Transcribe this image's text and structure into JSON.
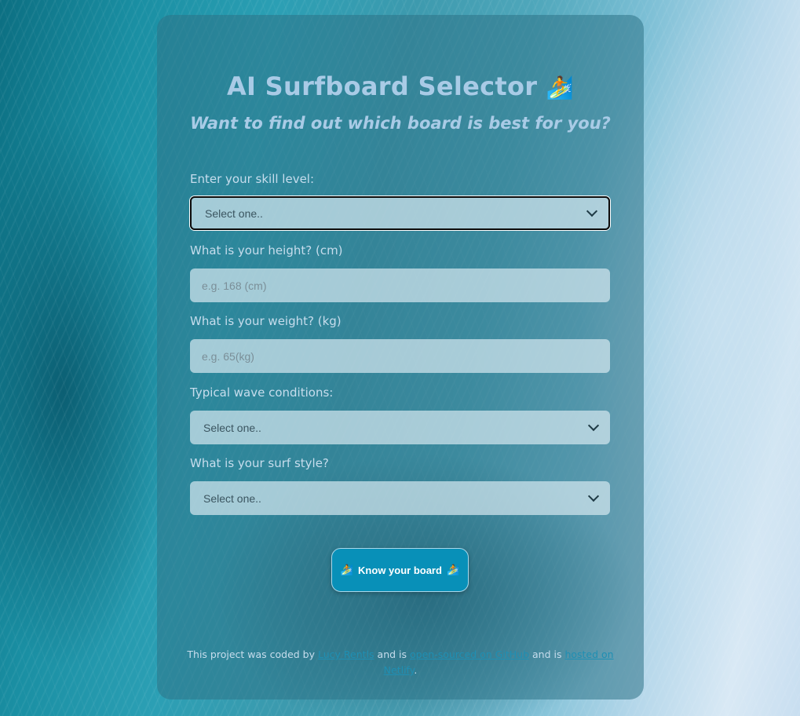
{
  "header": {
    "title": "AI Surfboard Selector",
    "title_emoji": "🏄",
    "subtitle": "Want to find out which board is best for you?"
  },
  "form": {
    "skill": {
      "label": "Enter your skill level:",
      "selected": "Select one.."
    },
    "height": {
      "label": "What is your height? (cm)",
      "placeholder": "e.g. 168 (cm)",
      "value": ""
    },
    "weight": {
      "label": "What is your weight? (kg)",
      "placeholder": "e.g. 65(kg)",
      "value": ""
    },
    "waves": {
      "label": "Typical wave conditions:",
      "selected": "Select one.."
    },
    "style": {
      "label": "What is your surf style?",
      "selected": "Select one.."
    },
    "submit": {
      "label": "Know your board",
      "emoji": "🏄"
    }
  },
  "footer": {
    "text_1": "This project was coded by",
    "link_author": "Lucy Rentls",
    "text_2": "and is",
    "link_github": "open-sourced on GitHub",
    "text_3": "and is",
    "link_netlify": "hosted on Netlify",
    "text_4": "."
  },
  "colors": {
    "accent": "#0890b8",
    "heading": "#a9cbe6",
    "link": "#1f8fb3"
  },
  "icons": {
    "title_icon": "surfer-icon",
    "select_icon": "chevron-down-icon"
  }
}
